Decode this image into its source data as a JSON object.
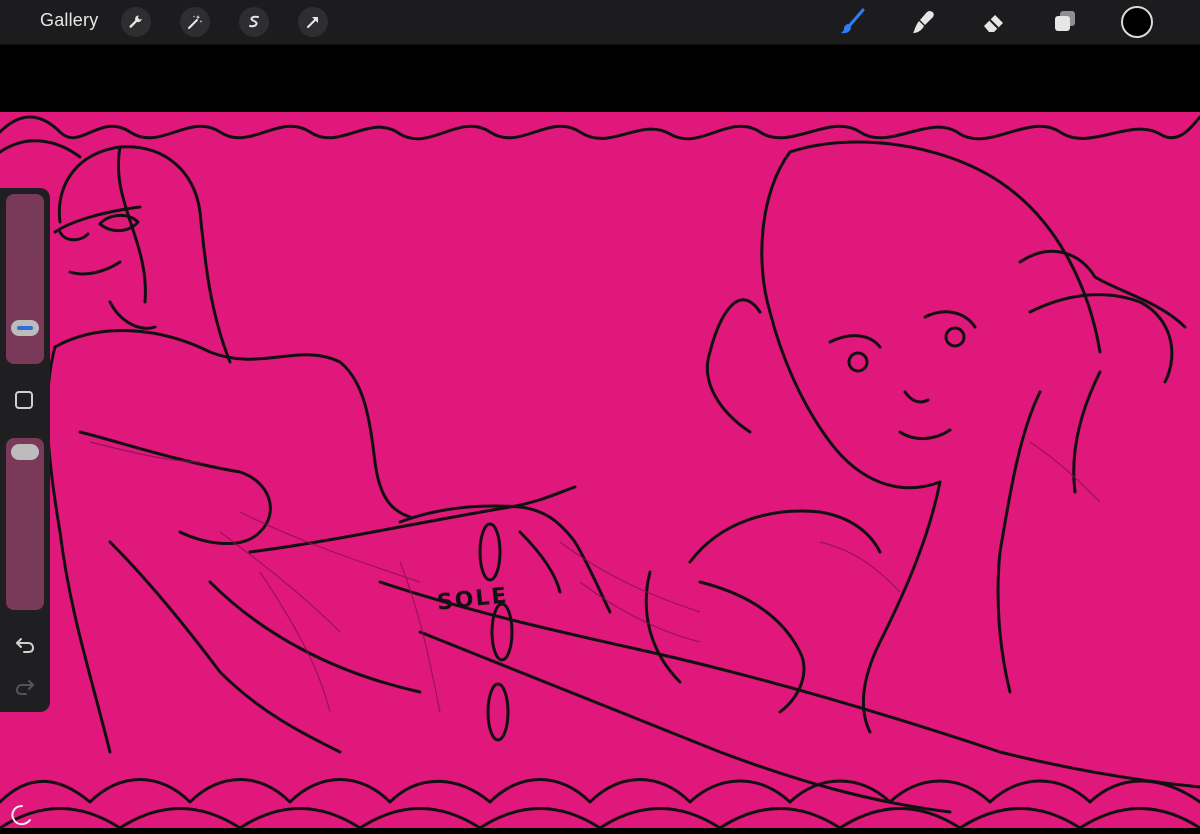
{
  "toolbar": {
    "gallery_label": "Gallery",
    "left_tools": [
      "wrench-icon",
      "magic-wand-icon",
      "selection-icon",
      "transform-arrow-icon"
    ],
    "right_tools": [
      "brush-icon",
      "smudge-icon",
      "eraser-icon",
      "layers-icon"
    ],
    "active_tool": "brush-icon",
    "accent_color": "#2f7cf6",
    "current_color": "#000000"
  },
  "canvas": {
    "background_color": "#e0187b",
    "sketch_text": "SOLE"
  },
  "sidebar": {
    "brush_size_level": 0.25,
    "opacity_level": 0.05,
    "controls": [
      "brush-size-slider",
      "modify-button",
      "opacity-slider",
      "undo-icon",
      "redo-icon"
    ]
  }
}
